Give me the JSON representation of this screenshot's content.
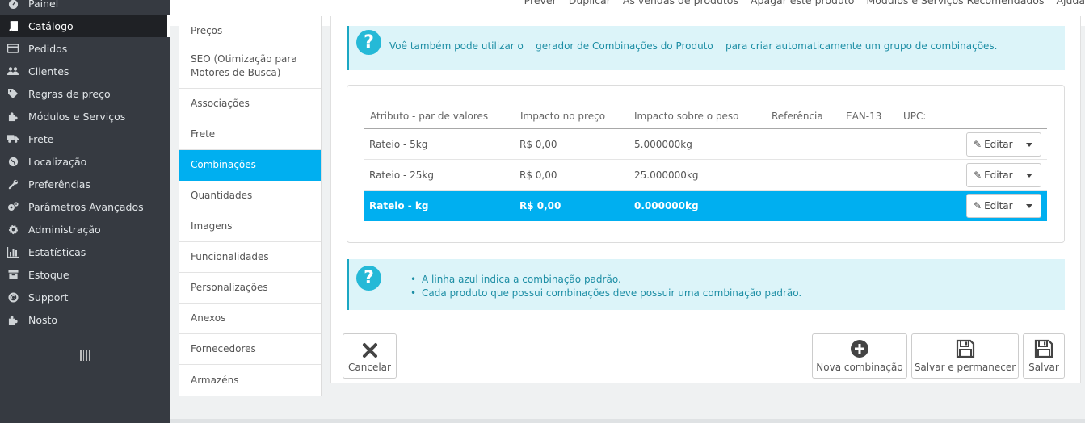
{
  "sidebar": {
    "items": [
      {
        "label": "Painel",
        "icon": "dashboard-icon"
      },
      {
        "label": "Catálogo",
        "icon": "book-icon",
        "active": true
      },
      {
        "label": "Pedidos",
        "icon": "credit-card-icon"
      },
      {
        "label": "Clientes",
        "icon": "users-icon"
      },
      {
        "label": "Regras de preço",
        "icon": "tags-icon"
      },
      {
        "label": "Módulos e Serviços",
        "icon": "puzzle-icon"
      },
      {
        "label": "Frete",
        "icon": "truck-icon"
      },
      {
        "label": "Localização",
        "icon": "globe-icon"
      },
      {
        "label": "Preferências",
        "icon": "wrench-icon"
      },
      {
        "label": "Parâmetros Avançados",
        "icon": "cogs-icon"
      },
      {
        "label": "Administração",
        "icon": "gear-icon"
      },
      {
        "label": "Estatísticas",
        "icon": "bar-chart-icon"
      },
      {
        "label": "Estoque",
        "icon": "archive-icon"
      },
      {
        "label": "Support",
        "icon": "lifebuoy-icon"
      },
      {
        "label": "Nosto",
        "icon": "puzzle-icon"
      }
    ]
  },
  "toolbar": {
    "links": [
      "Prever",
      "Duplicar",
      "As vendas de produtos",
      "Apagar este produto",
      "Módulos e Serviços Recomendados",
      "Ajuda"
    ]
  },
  "tabs": [
    {
      "label": "Preços"
    },
    {
      "label": "SEO (Otimização para Motores de Busca)"
    },
    {
      "label": "Associações"
    },
    {
      "label": "Frete"
    },
    {
      "label": "Combinações",
      "active": true
    },
    {
      "label": "Quantidades"
    },
    {
      "label": "Imagens"
    },
    {
      "label": "Funcionalidades"
    },
    {
      "label": "Personalizações"
    },
    {
      "label": "Anexos"
    },
    {
      "label": "Fornecedores"
    },
    {
      "label": "Armazéns"
    }
  ],
  "info_top": {
    "before": "Voê também pode utilizar o",
    "link": "gerador de Combinações do Produto",
    "after": "para criar automaticamente um grupo de combinações."
  },
  "table": {
    "headers": [
      "Atributo - par de valores",
      "Impacto no preço",
      "Impacto sobre o peso",
      "Referência",
      "EAN-13",
      "UPC:"
    ],
    "rows": [
      {
        "attribute": "Rateio - 5kg",
        "price": "R$ 0,00",
        "weight": "5.000000kg",
        "edit": "Editar",
        "selected": false
      },
      {
        "attribute": "Rateio - 25kg",
        "price": "R$ 0,00",
        "weight": "25.000000kg",
        "edit": "Editar",
        "selected": false
      },
      {
        "attribute": "Rateio - kg",
        "price": "R$ 0,00",
        "weight": "0.000000kg",
        "edit": "Editar",
        "selected": true
      }
    ]
  },
  "info_bottom": {
    "items": [
      "A linha azul indica a combinação padrão.",
      "Cada produto que possui combinações deve possuir uma combinação padrão."
    ]
  },
  "footer": {
    "cancel": "Cancelar",
    "new_combination": "Nova combinação",
    "save_stay": "Salvar e permanecer",
    "save": "Salvar"
  },
  "colors": {
    "sidebar_bg": "#363a41",
    "accent": "#00aff0",
    "info_bg": "#dcf4f9",
    "info_icon": "#25b9d7"
  }
}
